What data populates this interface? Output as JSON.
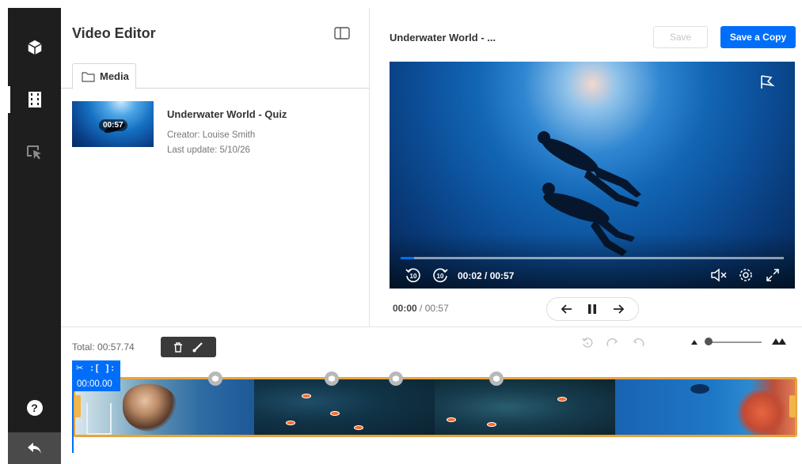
{
  "rail": {
    "items": [
      {
        "name": "content-icon"
      },
      {
        "name": "video-editor-icon"
      },
      {
        "name": "hotspots-icon"
      }
    ],
    "help_label": "?"
  },
  "editor": {
    "title": "Video Editor",
    "media_tab_label": "Media",
    "entry": {
      "title": "Underwater World - Quiz",
      "creator": "Creator: Louise Smith",
      "last_update": "Last update: 5/10/26",
      "duration": "00:57"
    }
  },
  "player": {
    "title": "Underwater World - ...",
    "save_label": "Save",
    "save_copy_label": "Save a Copy",
    "time_display": "00:02 / 00:57",
    "progress_fraction": 0.035,
    "current_time": "00:00",
    "separator": "/",
    "total_time": "00:57"
  },
  "timeline": {
    "total_label": "Total: 00:57.74",
    "clip_timestamp": "00:00.00",
    "clip_tool_icons": "✂ :[ ]:"
  },
  "colors": {
    "accent": "#006efa",
    "clip_border": "#e8a33a",
    "rail_bg": "#1e1e1e"
  }
}
